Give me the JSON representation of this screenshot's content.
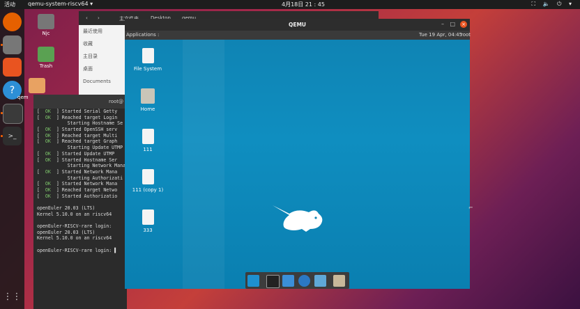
{
  "topbar": {
    "activities": "活动",
    "app_menu": "qemu-system-riscv64 ▾",
    "clock": "4月18日 21 : 45",
    "tray": "⛶ 🔈 ⏻ ▾"
  },
  "desktop": {
    "icons": [
      {
        "label": "Njc"
      },
      {
        "label": "Trash"
      },
      {
        "label": "qem"
      }
    ]
  },
  "files_window": {
    "tab1": "主文件夹",
    "tab2": "Desktop",
    "tab3": "qemu",
    "sidebar": [
      "最近使用",
      "收藏",
      "主目录",
      "桌面",
      "Documents"
    ]
  },
  "terminal": {
    "title": "root@",
    "lines": [
      {
        "ok": true,
        "text": " Started Serial Getty"
      },
      {
        "ok": true,
        "text": " Reached target Login"
      },
      {
        "ok": false,
        "text": "           Starting Hostname Se"
      },
      {
        "ok": true,
        "text": " Started OpenSSH serv"
      },
      {
        "ok": true,
        "text": " Reached target Multi"
      },
      {
        "ok": true,
        "text": " Reached target Graph"
      },
      {
        "ok": false,
        "text": "           Starting Update UTMP"
      },
      {
        "ok": true,
        "text": " Started Update UTMP"
      },
      {
        "ok": true,
        "text": " Started Hostname Ser"
      },
      {
        "ok": false,
        "text": "           Starting Network Mana"
      },
      {
        "ok": true,
        "text": " Started Network Mana"
      },
      {
        "ok": false,
        "text": "           Starting Authorizati"
      },
      {
        "ok": true,
        "text": " Started Network Mana"
      },
      {
        "ok": true,
        "text": " Reached target Netwo"
      },
      {
        "ok": true,
        "text": " Started Authorizatio"
      },
      {
        "ok": false,
        "text": ""
      },
      {
        "ok": false,
        "text": "openEuler 20.03 (LTS)"
      },
      {
        "ok": false,
        "text": "Kernel 5.10.0 on an riscv64"
      },
      {
        "ok": false,
        "text": ""
      },
      {
        "ok": false,
        "text": "openEuler-RISCV-rare login:"
      },
      {
        "ok": false,
        "text": "openEuler 20.03 (LTS)"
      },
      {
        "ok": false,
        "text": "Kernel 5.10.0 on an riscv64"
      },
      {
        "ok": false,
        "text": ""
      },
      {
        "ok": false,
        "text": "openEuler-RISCV-rare login: ▌"
      }
    ],
    "ok_tag": "OK"
  },
  "qemu": {
    "title": "QEMU",
    "panel": {
      "applications": "Applications :",
      "clock": "Tue 19 Apr, 04:45",
      "user": "root"
    },
    "icons": [
      {
        "label": "File System"
      },
      {
        "label": "Home"
      },
      {
        "label": "111"
      },
      {
        "label": "111 (copy 1)"
      },
      {
        "label": "333"
      }
    ]
  },
  "colors": {
    "accent": "#e95420",
    "xfce_blue": "#0f84b4",
    "ok_green": "#7ec66b"
  }
}
